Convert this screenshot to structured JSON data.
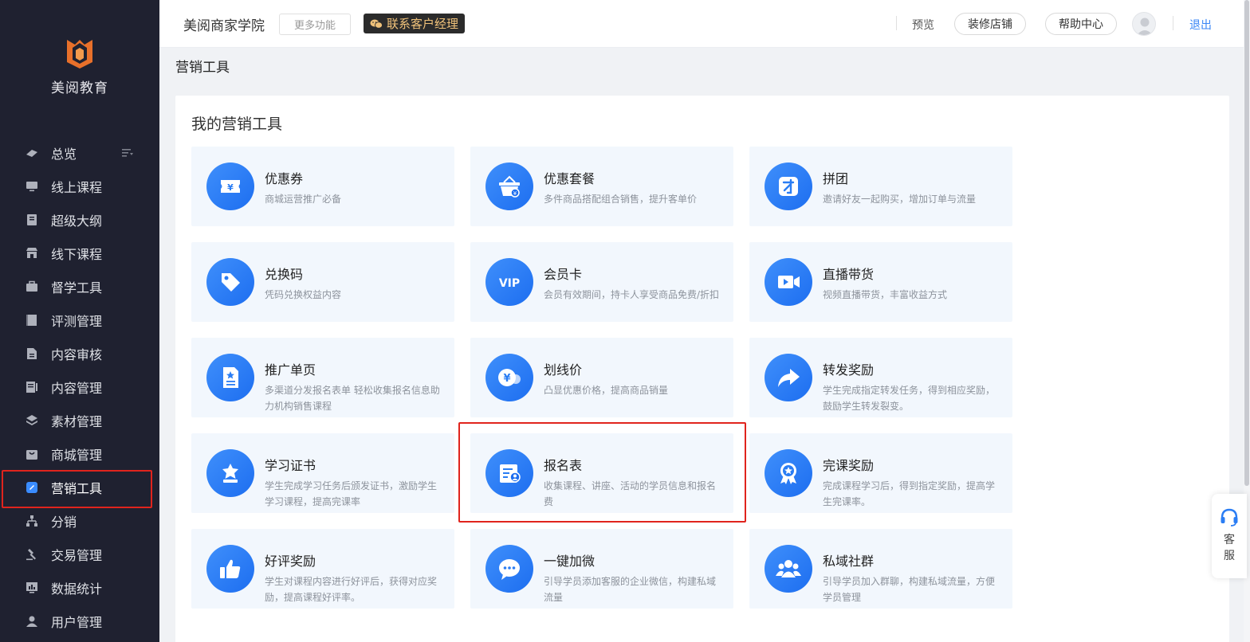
{
  "sidebar": {
    "logo_text": "美阅教育",
    "items": [
      {
        "label": "总览",
        "icon": "overview-icon"
      },
      {
        "label": "线上课程",
        "icon": "monitor-icon"
      },
      {
        "label": "超级大纲",
        "icon": "book-icon"
      },
      {
        "label": "线下课程",
        "icon": "store-icon"
      },
      {
        "label": "督学工具",
        "icon": "briefcase-icon"
      },
      {
        "label": "评测管理",
        "icon": "test-icon"
      },
      {
        "label": "内容审核",
        "icon": "document-icon"
      },
      {
        "label": "内容管理",
        "icon": "list-doc-icon"
      },
      {
        "label": "素材管理",
        "icon": "layers-icon"
      },
      {
        "label": "商城管理",
        "icon": "bag-icon"
      },
      {
        "label": "营销工具",
        "icon": "marketing-icon",
        "active": true
      },
      {
        "label": "分销",
        "icon": "network-icon"
      },
      {
        "label": "交易管理",
        "icon": "gavel-icon"
      },
      {
        "label": "数据统计",
        "icon": "chart-icon"
      },
      {
        "label": "用户管理",
        "icon": "user-icon"
      }
    ]
  },
  "header": {
    "title": "美阅商家学院",
    "more_label": "更多功能",
    "contact_label": "联系客户经理",
    "preview_label": "预览",
    "decorate_label": "装修店铺",
    "help_label": "帮助中心",
    "logout_label": "退出"
  },
  "page": {
    "title": "营销工具",
    "panel_title": "我的营销工具"
  },
  "tools": [
    {
      "title": "优惠券",
      "desc": "商城运营推广必备",
      "icon": "coupon-icon"
    },
    {
      "title": "优惠套餐",
      "desc": "多件商品搭配组合销售，提升客单价",
      "icon": "basket-icon"
    },
    {
      "title": "拼团",
      "desc": "邀请好友一起购买，增加订单与流量",
      "icon": "group-buy-icon"
    },
    {
      "title": "兑换码",
      "desc": "凭码兑换权益内容",
      "icon": "tag-icon"
    },
    {
      "title": "会员卡",
      "desc": "会员有效期间，持卡人享受商品免费/折扣",
      "icon": "vip-icon"
    },
    {
      "title": "直播带货",
      "desc": "视频直播带货，丰富收益方式",
      "icon": "video-icon"
    },
    {
      "title": "推广单页",
      "desc": "多渠道分发报名表单 轻松收集报名信息助力机构销售课程",
      "icon": "page-icon"
    },
    {
      "title": "划线价",
      "desc": "凸显优惠价格，提高商品销量",
      "icon": "price-icon"
    },
    {
      "title": "转发奖励",
      "desc": "学生完成指定转发任务，得到相应奖励，鼓励学生转发裂变。",
      "icon": "share-icon"
    },
    {
      "title": "学习证书",
      "desc": "学生完成学习任务后颁发证书，激励学生学习课程，提高完课率",
      "icon": "certificate-icon"
    },
    {
      "title": "报名表",
      "desc": "收集课程、讲座、活动的学员信息和报名费",
      "icon": "form-icon"
    },
    {
      "title": "完课奖励",
      "desc": "完成课程学习后，得到指定奖励，提高学生完课率。",
      "icon": "medal-icon"
    },
    {
      "title": "好评奖励",
      "desc": "学生对课程内容进行好评后，获得对应奖励，提高课程好评率。",
      "icon": "thumbs-up-icon"
    },
    {
      "title": "一键加微",
      "desc": "引导学员添加客服的企业微信，构建私域流量",
      "icon": "chat-icon"
    },
    {
      "title": "私域社群",
      "desc": "引导学员加入群聊，构建私域流量，方便学员管理",
      "icon": "community-icon"
    }
  ],
  "cs_widget": {
    "label": "客服"
  },
  "colors": {
    "accent": "#2a7df4",
    "sidebar_bg": "#1f2130",
    "highlight": "#e0241d",
    "card_bg": "#f2f7fd"
  }
}
